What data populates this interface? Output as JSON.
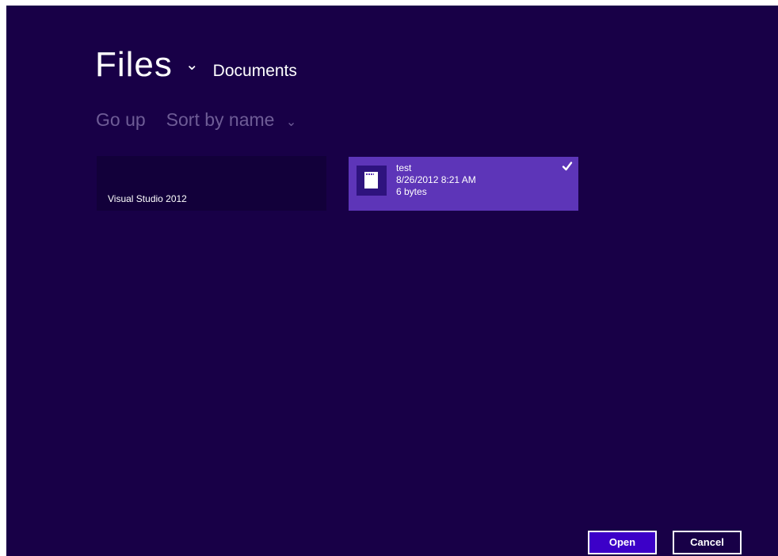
{
  "colors": {
    "background": "#180047",
    "folder_tile": "#12003a",
    "selected_tile": "#5d35b8",
    "command_text": "#6e5c96",
    "primary_button": "#3c00c8"
  },
  "header": {
    "title": "Files",
    "title_chevron_icon": "chevron-down-icon",
    "location": "Documents"
  },
  "commands": {
    "go_up": "Go up",
    "sort": "Sort by name",
    "sort_chevron_icon": "chevron-down-icon"
  },
  "items": [
    {
      "type": "folder",
      "name": "Visual Studio 2012",
      "selected": false
    },
    {
      "type": "file",
      "name": "test",
      "date": "8/26/2012 8:21 AM",
      "size": "6 bytes",
      "icon": "document-icon",
      "selected": true,
      "selected_icon": "checkmark-icon"
    }
  ],
  "footer": {
    "open_label": "Open",
    "cancel_label": "Cancel"
  }
}
